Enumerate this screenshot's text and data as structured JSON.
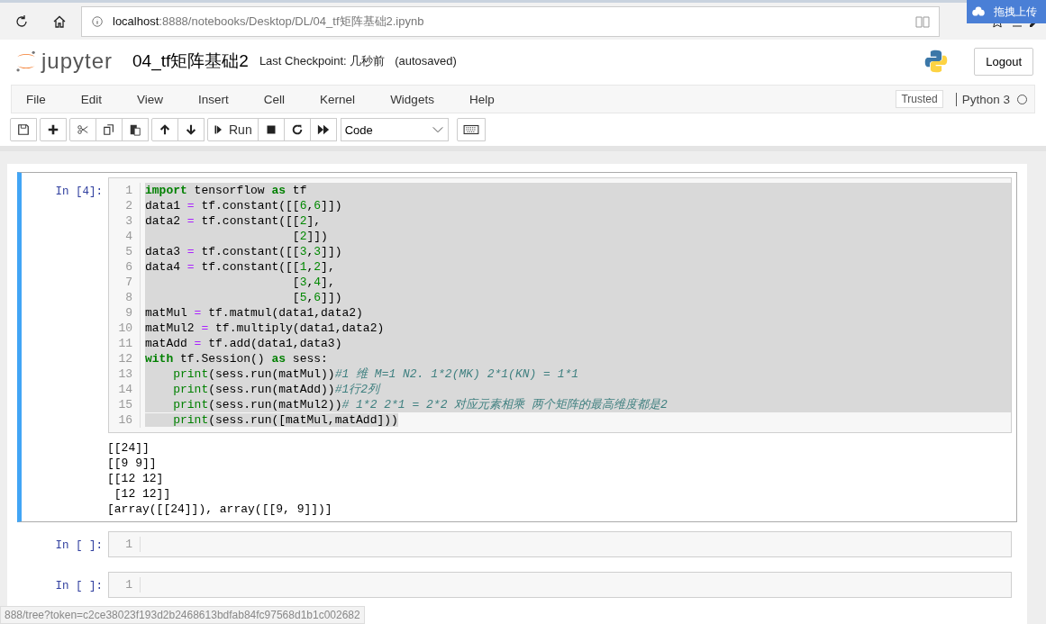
{
  "browser": {
    "url_host": "localhost",
    "url_path": ":8888/notebooks/Desktop/DL/04_tf矩阵基础2.ipynb",
    "extension_label": "拖拽上传"
  },
  "header": {
    "logo_text": "jupyter",
    "notebook_name": "04_tf矩阵基础2",
    "checkpoint": "Last Checkpoint: 几秒前",
    "autosave": "(autosaved)",
    "logout": "Logout"
  },
  "menu": [
    "File",
    "Edit",
    "View",
    "Insert",
    "Cell",
    "Kernel",
    "Widgets",
    "Help"
  ],
  "trusted": "Trusted",
  "kernel": {
    "name": "Python 3",
    "busy": false
  },
  "toolbar": {
    "run_label": "Run",
    "cell_type": "Code"
  },
  "cells": [
    {
      "prompt": "In [4]:",
      "selected": true,
      "lines": [
        {
          "number": "1",
          "kind": "full",
          "tokens": [
            {
              "kind": "kw",
              "t": "import"
            },
            {
              "kind": "plain",
              "t": " tensorflow "
            },
            {
              "kind": "kw",
              "t": "as"
            },
            {
              "kind": "plain",
              "t": " tf"
            }
          ]
        },
        {
          "number": "2",
          "kind": "full",
          "tokens": [
            {
              "kind": "plain",
              "t": "data1 "
            },
            {
              "kind": "op",
              "t": "="
            },
            {
              "kind": "plain",
              "t": " tf.constant([["
            },
            {
              "kind": "num",
              "t": "6"
            },
            {
              "kind": "plain",
              "t": ","
            },
            {
              "kind": "num",
              "t": "6"
            },
            {
              "kind": "plain",
              "t": "]])"
            }
          ]
        },
        {
          "number": "3",
          "kind": "full",
          "tokens": [
            {
              "kind": "plain",
              "t": "data2 "
            },
            {
              "kind": "op",
              "t": "="
            },
            {
              "kind": "plain",
              "t": " tf.constant([["
            },
            {
              "kind": "num",
              "t": "2"
            },
            {
              "kind": "plain",
              "t": "],"
            }
          ]
        },
        {
          "number": "4",
          "kind": "full",
          "tokens": [
            {
              "kind": "plain",
              "t": "                     ["
            },
            {
              "kind": "num",
              "t": "2"
            },
            {
              "kind": "plain",
              "t": "]])"
            }
          ]
        },
        {
          "number": "5",
          "kind": "full",
          "tokens": [
            {
              "kind": "plain",
              "t": "data3 "
            },
            {
              "kind": "op",
              "t": "="
            },
            {
              "kind": "plain",
              "t": " tf.constant([["
            },
            {
              "kind": "num",
              "t": "3"
            },
            {
              "kind": "plain",
              "t": ","
            },
            {
              "kind": "num",
              "t": "3"
            },
            {
              "kind": "plain",
              "t": "]])"
            }
          ]
        },
        {
          "number": "6",
          "kind": "full",
          "tokens": [
            {
              "kind": "plain",
              "t": "data4 "
            },
            {
              "kind": "op",
              "t": "="
            },
            {
              "kind": "plain",
              "t": " tf.constant([["
            },
            {
              "kind": "num",
              "t": "1"
            },
            {
              "kind": "plain",
              "t": ","
            },
            {
              "kind": "num",
              "t": "2"
            },
            {
              "kind": "plain",
              "t": "],"
            }
          ]
        },
        {
          "number": "7",
          "kind": "full",
          "tokens": [
            {
              "kind": "plain",
              "t": "                     ["
            },
            {
              "kind": "num",
              "t": "3"
            },
            {
              "kind": "plain",
              "t": ","
            },
            {
              "kind": "num",
              "t": "4"
            },
            {
              "kind": "plain",
              "t": "],"
            }
          ]
        },
        {
          "number": "8",
          "kind": "full",
          "tokens": [
            {
              "kind": "plain",
              "t": "                     ["
            },
            {
              "kind": "num",
              "t": "5"
            },
            {
              "kind": "plain",
              "t": ","
            },
            {
              "kind": "num",
              "t": "6"
            },
            {
              "kind": "plain",
              "t": "]])"
            }
          ]
        },
        {
          "number": "9",
          "kind": "full",
          "tokens": [
            {
              "kind": "plain",
              "t": "matMul "
            },
            {
              "kind": "op",
              "t": "="
            },
            {
              "kind": "plain",
              "t": " tf.matmul(data1,data2)"
            }
          ]
        },
        {
          "number": "10",
          "kind": "full",
          "tokens": [
            {
              "kind": "plain",
              "t": "matMul2 "
            },
            {
              "kind": "op",
              "t": "="
            },
            {
              "kind": "plain",
              "t": " tf.multiply(data1,data2)"
            }
          ]
        },
        {
          "number": "11",
          "kind": "full",
          "tokens": [
            {
              "kind": "plain",
              "t": "matAdd "
            },
            {
              "kind": "op",
              "t": "="
            },
            {
              "kind": "plain",
              "t": " tf.add(data1,data3)"
            }
          ]
        },
        {
          "number": "12",
          "kind": "full",
          "tokens": [
            {
              "kind": "kw",
              "t": "with"
            },
            {
              "kind": "plain",
              "t": " tf.Session() "
            },
            {
              "kind": "kw",
              "t": "as"
            },
            {
              "kind": "plain",
              "t": " sess:"
            }
          ]
        },
        {
          "number": "13",
          "kind": "full",
          "tokens": [
            {
              "kind": "builtin",
              "t": "    print"
            },
            {
              "kind": "plain",
              "t": "(sess.run(matMul))"
            },
            {
              "kind": "cmt",
              "t": "#1 维 M=1 N2. 1*2(MK) 2*1(KN) = 1*1"
            }
          ]
        },
        {
          "number": "14",
          "kind": "full",
          "tokens": [
            {
              "kind": "builtin",
              "t": "    print"
            },
            {
              "kind": "plain",
              "t": "(sess.run(matAdd))"
            },
            {
              "kind": "cmt",
              "t": "#1行2列"
            }
          ]
        },
        {
          "number": "15",
          "kind": "full",
          "tokens": [
            {
              "kind": "builtin",
              "t": "    print"
            },
            {
              "kind": "plain",
              "t": "(sess.run(matMul2))"
            },
            {
              "kind": "cmt",
              "t": "# 1*2 2*1 = 2*2 对应元素相乘 两个矩阵的最高维度都是2"
            }
          ]
        },
        {
          "number": "16",
          "kind": "partial",
          "tokens": [
            {
              "kind": "builtin",
              "t": "    print"
            },
            {
              "kind": "plain",
              "t": "(sess.run([matMul,matAdd]))"
            }
          ]
        }
      ],
      "output": [
        "[[24]]",
        "[[9 9]]",
        "[[12 12]",
        " [12 12]]",
        "[array([[24]]), array([[9, 9]])]"
      ]
    },
    {
      "prompt": "In [ ]:",
      "selected": false,
      "lines": [
        {
          "number": "1",
          "kind": "plain"
        }
      ]
    },
    {
      "prompt": "In [ ]:",
      "selected": false,
      "lines": [
        {
          "number": "1",
          "kind": "plain"
        }
      ]
    }
  ],
  "status_url": "888/tree?token=c2ce38023f193d2b2468613bdfab84fc97568d1b1c002682"
}
